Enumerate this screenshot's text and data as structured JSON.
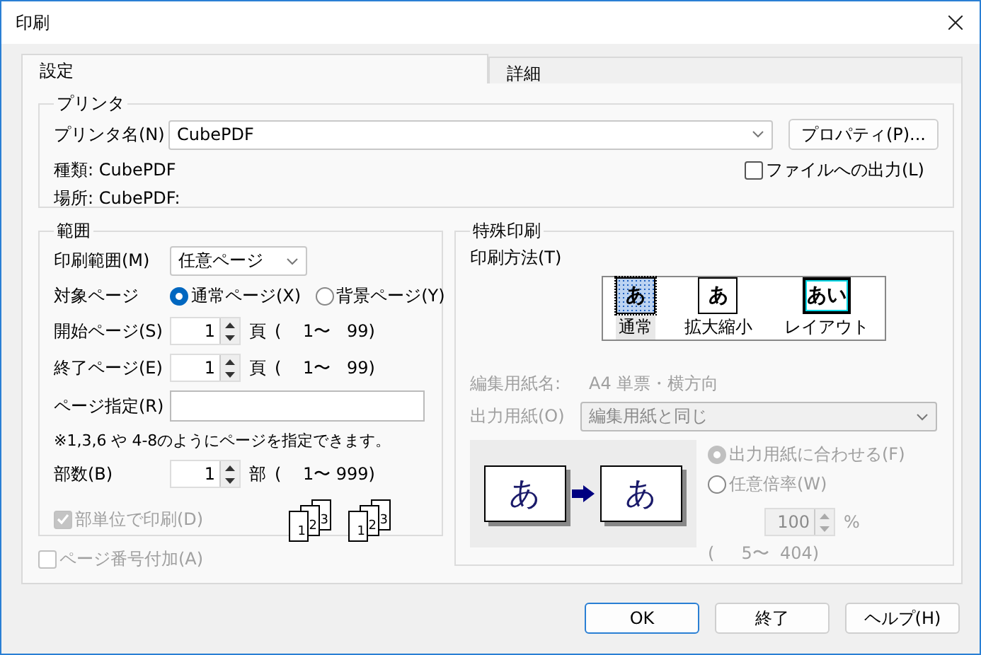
{
  "window": {
    "title": "印刷"
  },
  "tabs": [
    {
      "label": "設定",
      "selected": true
    },
    {
      "label": "詳細",
      "selected": false
    }
  ],
  "printer": {
    "legend": "プリンタ",
    "name_label": "プリンタ名(N)",
    "name_value": "CubePDF",
    "properties_button": "プロパティ(P)...",
    "type_label": "種類:",
    "type_value": "CubePDF",
    "location_label": "場所:",
    "location_value": "CubePDF:",
    "print_to_file": {
      "label": "ファイルへの出力(L)",
      "checked": false
    }
  },
  "range": {
    "legend": "範囲",
    "range_label": "印刷範囲(M)",
    "range_value": "任意ページ",
    "target_label": "対象ページ",
    "target_options": [
      {
        "label": "通常ページ(X)",
        "selected": true
      },
      {
        "label": "背景ページ(Y)",
        "selected": false
      }
    ],
    "page_spinners": [
      {
        "label": "開始ページ(S)",
        "value": "1",
        "unit": "頁",
        "limits": "(    1〜   99)"
      },
      {
        "label": "終了ページ(E)",
        "value": "1",
        "unit": "頁",
        "limits": "(    1〜   99)"
      }
    ],
    "page_spec_label": "ページ指定(R)",
    "hint": "※1,3,6 や 4-8のようにページを指定できます。",
    "copies": {
      "label": "部数(B)",
      "value": "1",
      "unit": "部",
      "limits": "(    1〜 999)"
    },
    "collate": {
      "label": "部単位で印刷(D)",
      "checked": true,
      "disabled": true
    },
    "collate_stacks": [
      [
        "1",
        "2",
        "3"
      ],
      [
        "1",
        "2",
        "3"
      ]
    ]
  },
  "page_numbers": {
    "label": "ページ番号付加(A)",
    "checked": false,
    "disabled": true
  },
  "special": {
    "legend": "特殊印刷",
    "method_label": "印刷方法(T)",
    "methods": [
      {
        "kind": "normal",
        "label": "通常",
        "glyph": "あ",
        "selected": true
      },
      {
        "kind": "scale",
        "label": "拡大縮小",
        "glyph": "あ",
        "selected": false
      },
      {
        "kind": "layout",
        "label": "レイアウト",
        "glyph": "あい",
        "selected": false
      }
    ],
    "disabled": true,
    "paper_name_label": "編集用紙名:",
    "paper_name_value": "A4 単票・横方向",
    "output_label": "出力用紙(O)",
    "output_value": "編集用紙と同じ",
    "preview_glyphs": [
      "あ",
      "あ"
    ],
    "fit_options": [
      {
        "label": "出力用紙に合わせる(F)",
        "selected": true
      },
      {
        "label": "任意倍率(W)",
        "selected": false
      }
    ],
    "zoom_value": "100",
    "zoom_unit": "%",
    "zoom_limits": "(     5〜  404)"
  },
  "buttons": [
    {
      "label": "OK",
      "default": true
    },
    {
      "label": "終了",
      "default": false
    },
    {
      "label": "ヘルプ(H)",
      "default": false
    }
  ]
}
